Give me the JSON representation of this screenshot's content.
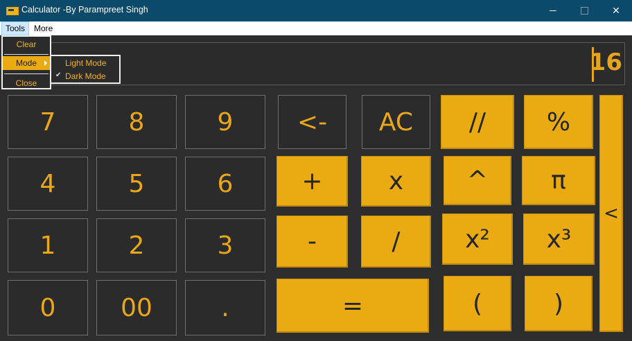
{
  "window": {
    "title": "Calculator -By Parampreet Singh",
    "min_glyph": "",
    "close_glyph": "✕"
  },
  "menubar": {
    "tools": "Tools",
    "more": "More"
  },
  "tools_menu": {
    "clear": "Clear",
    "mode": "Mode",
    "close": "Close",
    "mode_submenu": {
      "light": "Light Mode",
      "dark": "Dark Mode",
      "checked": "Dark Mode",
      "check_glyph": "✔"
    }
  },
  "display": {
    "value": "16"
  },
  "buttons": {
    "seven": "7",
    "eight": "8",
    "nine": "9",
    "backspace": "<-",
    "ac": "AC",
    "floor_div": "//",
    "percent": "%",
    "collapse": "<",
    "four": "4",
    "five": "5",
    "six": "6",
    "plus": "+",
    "multiply": "x",
    "power": "^",
    "pi": "π",
    "one": "1",
    "two": "2",
    "three": "3",
    "minus": "-",
    "divide": "/",
    "square": "x²",
    "cube": "x³",
    "zero": "0",
    "double_zero": "00",
    "dot": ".",
    "equals": "=",
    "open_paren": "(",
    "close_paren": ")"
  },
  "colors": {
    "accent": "#eaaa12",
    "background": "#2d2d2d",
    "titlebar": "#0b4a6b",
    "text_accent": "#e7a51c"
  }
}
